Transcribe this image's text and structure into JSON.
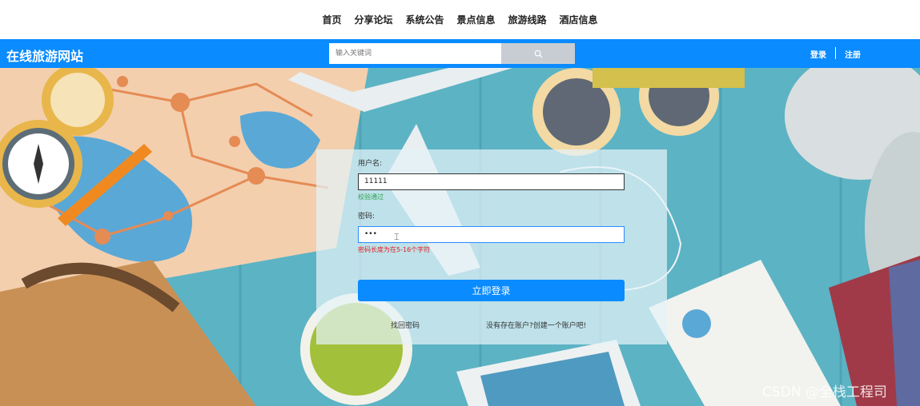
{
  "topnav": {
    "items": [
      "首页",
      "分享论坛",
      "系统公告",
      "景点信息",
      "旅游线路",
      "酒店信息"
    ]
  },
  "header": {
    "site_title": "在线旅游网站",
    "search_placeholder": "输入关键词",
    "login_label": "登录",
    "register_label": "注册",
    "bar_color": "#0a8bff"
  },
  "login_form": {
    "username_label": "用户名:",
    "username_value": "11111",
    "username_msg": "校验通过",
    "password_label": "密码:",
    "password_value": "•••",
    "password_msg": "密码长度为在5-16个字符",
    "submit_label": "立即登录",
    "forgot_link": "找回密码",
    "register_link": "没有存在账户?创建一个账户吧!"
  },
  "watermark": "CSDN @全栈工程司",
  "colors": {
    "accent": "#0a8bff",
    "ok": "#2da44e",
    "error": "#e02020"
  },
  "icons": {
    "search": "search-icon",
    "cursor": "text-cursor-icon"
  }
}
